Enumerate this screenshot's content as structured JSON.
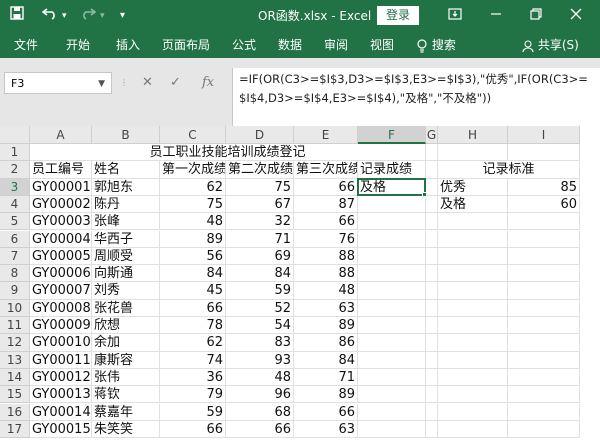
{
  "titlebar": {
    "filename": "OR函数.xlsx",
    "separator": "-",
    "app": "Excel",
    "login": "登录",
    "icons": [
      "save-icon",
      "undo-icon",
      "redo-icon",
      "customize-icon",
      "ribbon-options-icon",
      "minimize-icon",
      "restore-icon",
      "close-icon"
    ]
  },
  "ribbon": {
    "tabs": [
      "文件",
      "开始",
      "插入",
      "页面布局",
      "公式",
      "数据",
      "审阅",
      "视图"
    ],
    "search": "搜索",
    "share": "共享(S)"
  },
  "formula_bar": {
    "name_box": "F3",
    "cancel": "✕",
    "enter": "✓",
    "fx": "fx",
    "formula_line1": "=IF(OR(C3>=$I$3,D3>=$I$3,E3>=$I$3),\"优秀\",IF(OR(C3>=",
    "formula_line2": "$I$4,D3>=$I$4,E3>=$I$4),\"及格\",\"不及格\"))"
  },
  "sheet": {
    "columns": [
      "A",
      "B",
      "C",
      "D",
      "E",
      "F",
      "G",
      "H",
      "I"
    ],
    "row_numbers": [
      "1",
      "2",
      "3",
      "4",
      "5",
      "6",
      "7",
      "8",
      "9",
      "10",
      "11",
      "12",
      "13",
      "14",
      "15",
      "16",
      "17"
    ],
    "title": "员工职业技能培训成绩登记",
    "headers": {
      "A": "员工编号",
      "B": "姓名",
      "C": "第一次成绩",
      "D": "第二次成绩",
      "E": "第三次成绩",
      "F": "记录成绩"
    },
    "rows": [
      {
        "id": "GY00001",
        "name": "郭旭东",
        "c": "62",
        "d": "75",
        "e": "66",
        "f": "及格"
      },
      {
        "id": "GY00002",
        "name": "陈丹",
        "c": "75",
        "d": "67",
        "e": "87",
        "f": ""
      },
      {
        "id": "GY00003",
        "name": "张峰",
        "c": "48",
        "d": "32",
        "e": "66",
        "f": ""
      },
      {
        "id": "GY00004",
        "name": "华西子",
        "c": "89",
        "d": "71",
        "e": "76",
        "f": ""
      },
      {
        "id": "GY00005",
        "name": "周顺受",
        "c": "56",
        "d": "69",
        "e": "88",
        "f": ""
      },
      {
        "id": "GY00006",
        "name": "向斯通",
        "c": "84",
        "d": "84",
        "e": "88",
        "f": ""
      },
      {
        "id": "GY00007",
        "name": "刘秀",
        "c": "45",
        "d": "59",
        "e": "48",
        "f": ""
      },
      {
        "id": "GY00008",
        "name": "张花兽",
        "c": "66",
        "d": "52",
        "e": "63",
        "f": ""
      },
      {
        "id": "GY00009",
        "name": "欣想",
        "c": "78",
        "d": "54",
        "e": "89",
        "f": ""
      },
      {
        "id": "GY00010",
        "name": "余加",
        "c": "62",
        "d": "83",
        "e": "86",
        "f": ""
      },
      {
        "id": "GY00011",
        "name": "康斯容",
        "c": "74",
        "d": "93",
        "e": "84",
        "f": ""
      },
      {
        "id": "GY00012",
        "name": "张伟",
        "c": "36",
        "d": "48",
        "e": "71",
        "f": ""
      },
      {
        "id": "GY00013",
        "name": "蒋钦",
        "c": "79",
        "d": "96",
        "e": "89",
        "f": ""
      },
      {
        "id": "GY00014",
        "name": "蔡嘉年",
        "c": "59",
        "d": "68",
        "e": "66",
        "f": ""
      },
      {
        "id": "GY00015",
        "name": "朱笑笑",
        "c": "66",
        "d": "66",
        "e": "63",
        "f": ""
      }
    ],
    "criteria": {
      "title": "记录标准",
      "items": [
        {
          "label": "优秀",
          "value": "85"
        },
        {
          "label": "及格",
          "value": "60"
        }
      ]
    },
    "selection_color": "#217346",
    "theme_color": "#217346"
  }
}
